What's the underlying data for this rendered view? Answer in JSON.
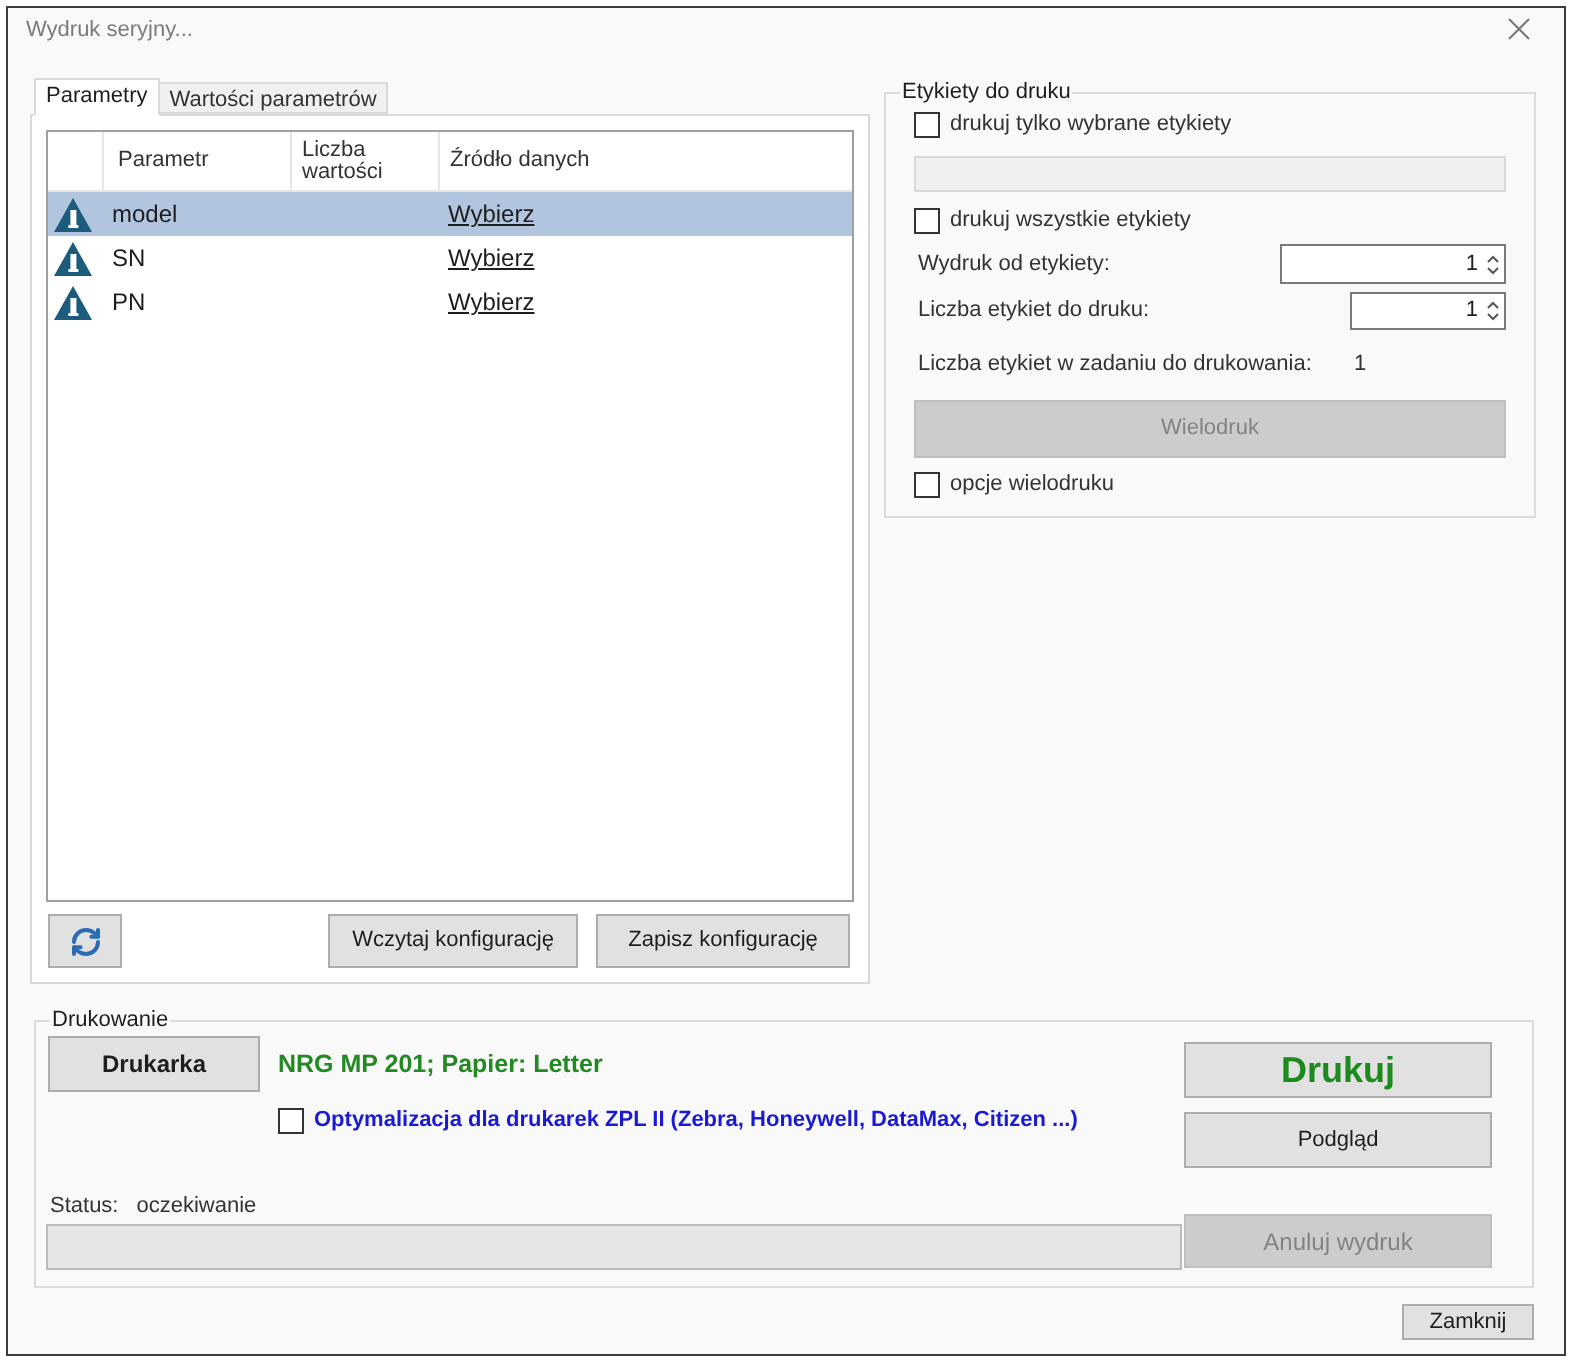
{
  "window": {
    "title": "Wydruk seryjny..."
  },
  "tabs": [
    {
      "label": "Parametry",
      "selected": true
    },
    {
      "label": "Wartości parametrów",
      "selected": false
    }
  ],
  "table": {
    "columns": [
      "Parametr",
      "Liczba wartości",
      "Źródło danych"
    ],
    "rows": [
      {
        "parameter": "model",
        "source": "Wybierz",
        "selected": true
      },
      {
        "parameter": "SN",
        "source": "Wybierz",
        "selected": false
      },
      {
        "parameter": "PN",
        "source": "Wybierz",
        "selected": false
      }
    ]
  },
  "config_buttons": [
    {
      "label": "Wczytaj konfigurację"
    },
    {
      "label": "Zapisz konfigurację"
    }
  ],
  "labels_group": {
    "title": "Etykiety do druku",
    "print_selected": {
      "label": "drukuj tylko wybrane etykiety",
      "checked": false
    },
    "selection_field": {
      "disabled": true
    },
    "print_all": {
      "label": "drukuj wszystkie etykiety",
      "checked": false
    },
    "start_from": {
      "label": "Wydruk od etykiety:",
      "value": "1"
    },
    "label_count": {
      "label": "Liczba etykiet do druku:",
      "value": "1"
    },
    "total": {
      "label": "Liczba etykiet w zadaniu do drukowania:",
      "value": "1"
    },
    "multiprint_button": {
      "label": "Wielodruk",
      "disabled": true
    },
    "multiprint_options": {
      "label": "opcje wielodruku",
      "checked": false
    }
  },
  "printing": {
    "title": "Drukowanie",
    "printer_button": {
      "label": "Drukarka"
    },
    "printer_info": "NRG MP 201; Papier: Letter",
    "zpl_option": {
      "label": "Optymalizacja dla drukarek ZPL II (Zebra, Honeywell, DataMax, Citizen ...)",
      "checked": false
    },
    "print_button": {
      "label": "Drukuj"
    },
    "preview_button": {
      "label": "Podgląd"
    },
    "status_label": "Status:",
    "status_value": "oczekiwanie",
    "progress": {
      "level": 0
    },
    "cancel_button": {
      "label": "Anuluj wydruk",
      "disabled": true
    }
  },
  "footer": {
    "close_button": {
      "label": "Zamknij"
    }
  }
}
